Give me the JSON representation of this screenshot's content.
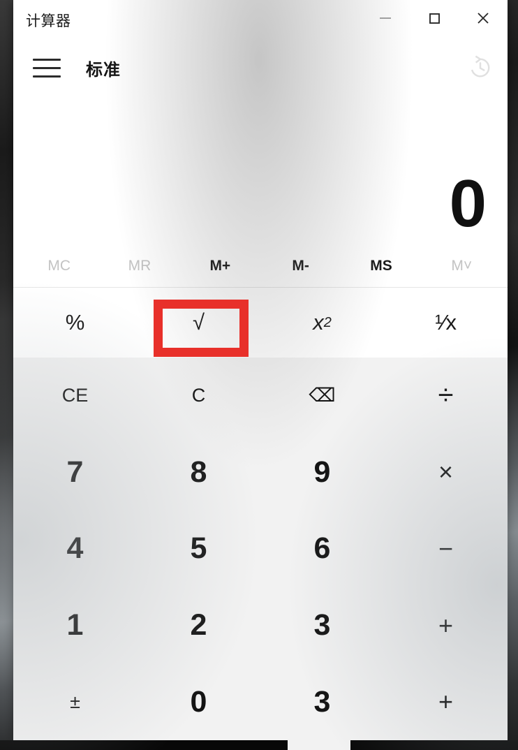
{
  "window": {
    "title": "计算器",
    "caption_buttons": [
      {
        "name": "minimize",
        "label": "─"
      },
      {
        "name": "maximize",
        "label": "□"
      },
      {
        "name": "close",
        "label": "✕"
      }
    ]
  },
  "modebar": {
    "menu_icon": "hamburger-menu-icon",
    "mode_label": "标准",
    "history_icon": "history-clock-icon"
  },
  "display": {
    "expression": "",
    "value": "0"
  },
  "memory": {
    "buttons": [
      {
        "label": "MC",
        "enabled": false
      },
      {
        "label": "MR",
        "enabled": false
      },
      {
        "label": "M+",
        "enabled": true
      },
      {
        "label": "M-",
        "enabled": true
      },
      {
        "label": "MS",
        "enabled": true
      },
      {
        "label": "M˅",
        "enabled": false
      }
    ]
  },
  "functions": {
    "buttons": [
      {
        "name": "percent",
        "label": "%"
      },
      {
        "name": "square-root",
        "label": "√"
      },
      {
        "name": "squared",
        "label": "x²"
      },
      {
        "name": "reciprocal",
        "label": "¹⁄x"
      }
    ]
  },
  "annotation": {
    "target": "square-root",
    "color": "#e8302a",
    "shape": "rectangle-outline"
  },
  "keypad": {
    "rows": [
      [
        {
          "name": "clear-entry",
          "label": "CE",
          "kind": "small"
        },
        {
          "name": "clear",
          "label": "C",
          "kind": "small"
        },
        {
          "name": "backspace",
          "label": "⌫",
          "kind": "small"
        },
        {
          "name": "divide",
          "label": "÷",
          "kind": "op"
        }
      ],
      [
        {
          "name": "digit-7",
          "label": "7",
          "kind": "digit"
        },
        {
          "name": "digit-8",
          "label": "8",
          "kind": "digit"
        },
        {
          "name": "digit-9",
          "label": "9",
          "kind": "digit"
        },
        {
          "name": "multiply",
          "label": "×",
          "kind": "opthin"
        }
      ],
      [
        {
          "name": "digit-4",
          "label": "4",
          "kind": "digit"
        },
        {
          "name": "digit-5",
          "label": "5",
          "kind": "digit"
        },
        {
          "name": "digit-6",
          "label": "6",
          "kind": "digit"
        },
        {
          "name": "subtract",
          "label": "−",
          "kind": "opthin"
        }
      ],
      [
        {
          "name": "digit-1",
          "label": "1",
          "kind": "digit"
        },
        {
          "name": "digit-2",
          "label": "2",
          "kind": "digit"
        },
        {
          "name": "digit-3",
          "label": "3",
          "kind": "digit"
        },
        {
          "name": "add",
          "label": "+",
          "kind": "opthin"
        }
      ],
      [
        {
          "name": "plus-minus",
          "label": "±",
          "kind": "small"
        },
        {
          "name": "digit-0",
          "label": "0",
          "kind": "digit"
        },
        {
          "name": "digit-3-alt",
          "label": "3",
          "kind": "digit"
        },
        {
          "name": "add-alt",
          "label": "+",
          "kind": "opthin"
        }
      ]
    ]
  },
  "colors": {
    "window_bg": "#ffffff",
    "keypad_bg": "#f2f2f2",
    "text": "#121212",
    "disabled_text": "#c3c3c3",
    "annotation_red": "#e8302a"
  }
}
